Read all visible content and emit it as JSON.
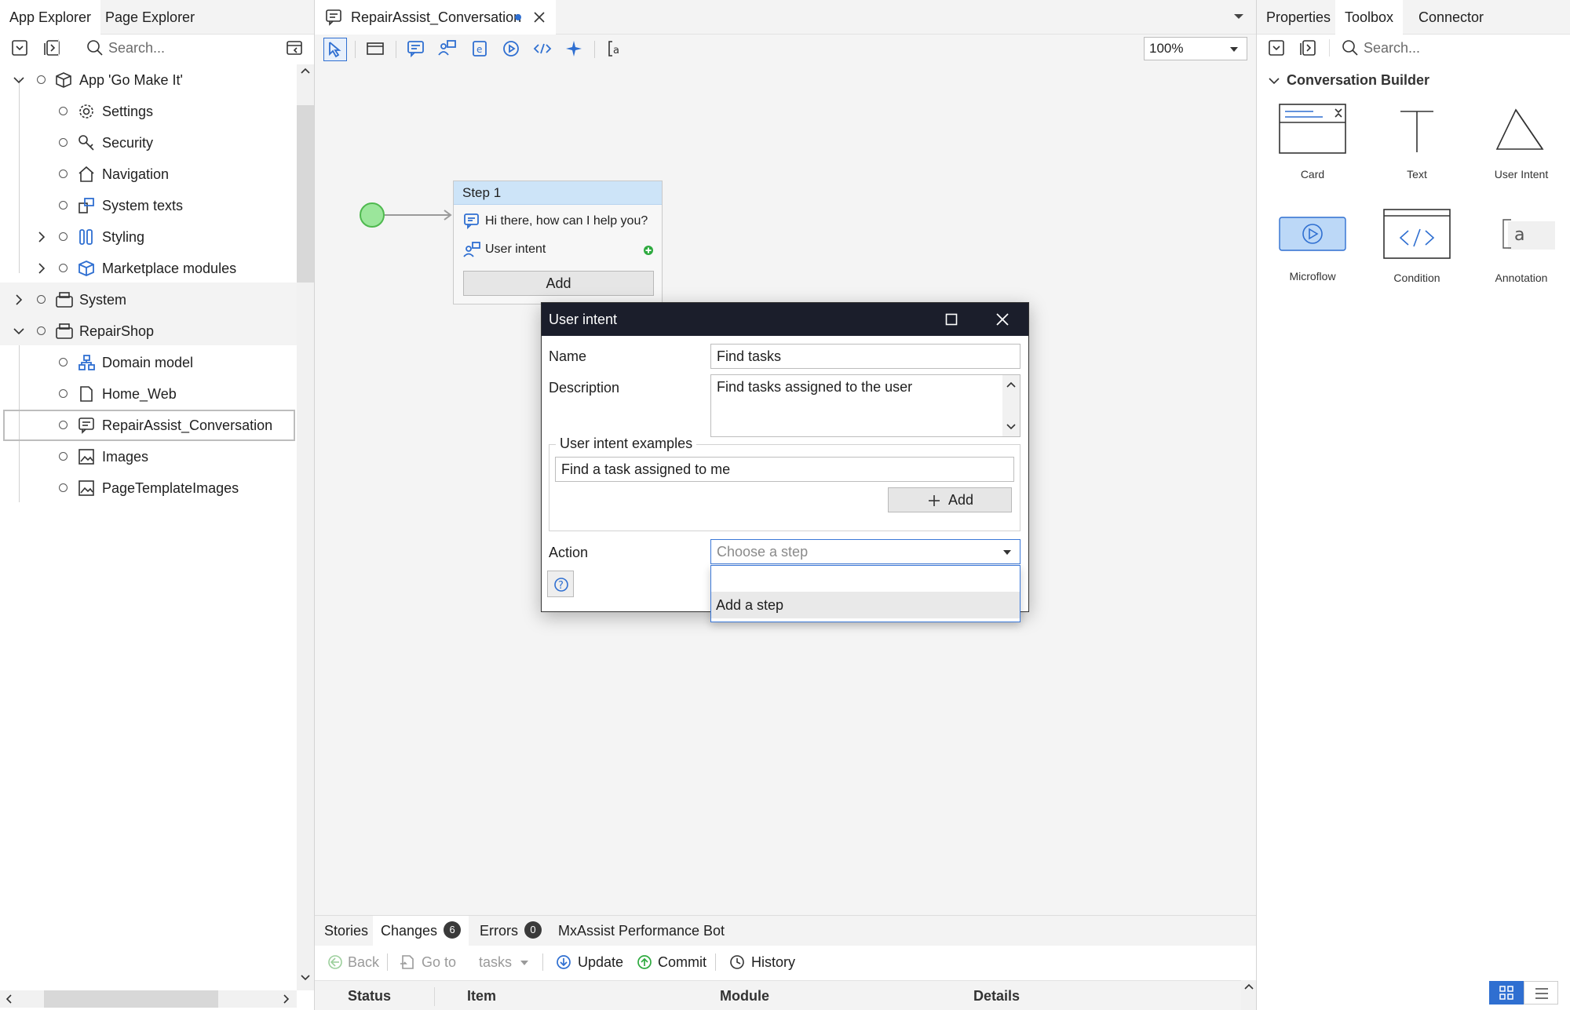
{
  "left_panel": {
    "tabs": [
      "App Explorer",
      "Page Explorer"
    ],
    "search_placeholder": "Search...",
    "tree": [
      {
        "label": "App 'Go Make It'",
        "icon": "cube-icon"
      },
      {
        "label": "Settings",
        "icon": "gear-icon"
      },
      {
        "label": "Security",
        "icon": "key-icon"
      },
      {
        "label": "Navigation",
        "icon": "home-icon"
      },
      {
        "label": "System texts",
        "icon": "system-texts-icon"
      },
      {
        "label": "Styling",
        "icon": "styling-icon"
      },
      {
        "label": "Marketplace modules",
        "icon": "marketplace-icon"
      },
      {
        "label": "System",
        "icon": "module-icon"
      },
      {
        "label": "RepairShop",
        "icon": "module-icon"
      },
      {
        "label": "Domain model",
        "icon": "domain-model-icon"
      },
      {
        "label": "Home_Web",
        "icon": "page-icon"
      },
      {
        "label": "RepairAssist_Conversation",
        "icon": "conversation-icon"
      },
      {
        "label": "Images",
        "icon": "image-icon"
      },
      {
        "label": "PageTemplateImages",
        "icon": "image-icon"
      }
    ]
  },
  "editor": {
    "tab_label": "RepairAssist_Conversation",
    "zoom": "100%",
    "step": {
      "title": "Step 1",
      "message": "Hi there, how can I help you?",
      "intent": "User intent",
      "add_label": "Add"
    }
  },
  "dialog": {
    "title": "User intent",
    "name_label": "Name",
    "name_value": "Find tasks",
    "description_label": "Description",
    "description_value": "Find tasks assigned to the user",
    "examples_legend": "User intent examples",
    "example_value": "Find a task assigned to me",
    "add_label": "Add",
    "action_label": "Action",
    "action_placeholder": "Choose a step",
    "dropdown_options": [
      "",
      "Add a step"
    ]
  },
  "bottom_panel": {
    "tabs": [
      {
        "label": "Stories"
      },
      {
        "label": "Changes",
        "count": "6"
      },
      {
        "label": "Errors",
        "count": "0"
      },
      {
        "label": "MxAssist Performance Bot"
      }
    ],
    "toolbar": {
      "back": "Back",
      "goto": "Go to",
      "filter": "tasks",
      "update": "Update",
      "commit": "Commit",
      "history": "History"
    },
    "columns": [
      "Status",
      "Item",
      "Module",
      "Details"
    ]
  },
  "right_panel": {
    "tabs": [
      "Properties",
      "Toolbox",
      "Connector"
    ],
    "search_placeholder": "Search...",
    "section": "Conversation Builder",
    "tools": [
      "Card",
      "Text",
      "User Intent",
      "Microflow",
      "Condition",
      "Annotation"
    ]
  },
  "colors": {
    "accent": "#2f6fd1",
    "dialog_title": "#1b1e2b",
    "step_header": "#cde4f8",
    "start_node": "#9be69b"
  }
}
